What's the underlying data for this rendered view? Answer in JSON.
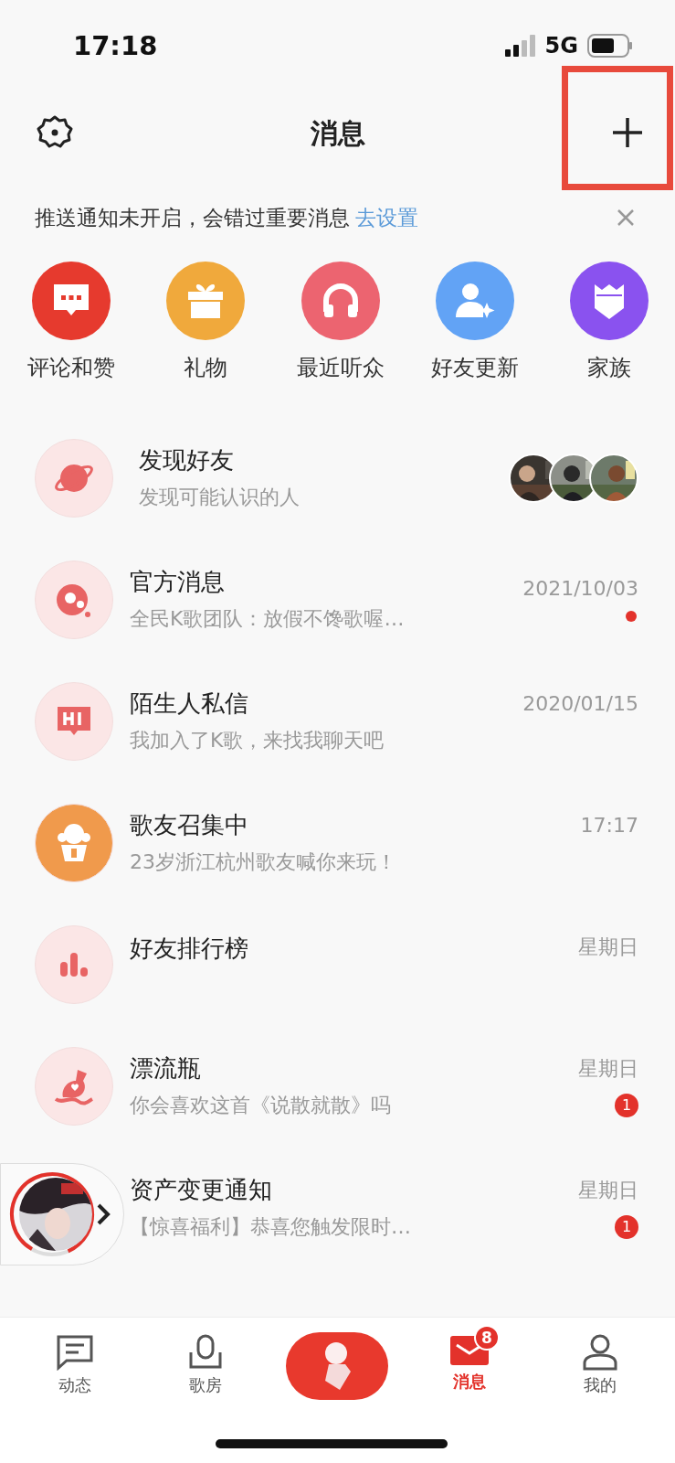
{
  "status_bar": {
    "time": "17:18",
    "network": "5G"
  },
  "header": {
    "title": "消息"
  },
  "notice": {
    "text": "推送通知未开启，会错过重要消息",
    "link": "去设置"
  },
  "quick_actions": [
    {
      "label": "评论和赞",
      "color": "#e63a2e"
    },
    {
      "label": "礼物",
      "color": "#f0a93c"
    },
    {
      "label": "最近听众",
      "color": "#ec6470"
    },
    {
      "label": "好友更新",
      "color": "#62a3f5"
    },
    {
      "label": "家族",
      "color": "#8a52ef"
    }
  ],
  "discover": {
    "title": "发现好友",
    "subtitle": "发现可能认识的人"
  },
  "messages": [
    {
      "title": "官方消息",
      "preview": "全民K歌团队：放假不馋歌喔…",
      "time": "2021/10/03",
      "unread_dot": true
    },
    {
      "title": "陌生人私信",
      "preview": "我加入了K歌，来找我聊天吧",
      "time": "2020/01/15",
      "unread_dot": false
    },
    {
      "title": "歌友召集中",
      "preview": "23岁浙江杭州歌友喊你来玩！",
      "time": "17:17",
      "unread_dot": false
    },
    {
      "title": "好友排行榜",
      "time": "星期日",
      "unread_dot": false
    },
    {
      "title": "漂流瓶",
      "preview": "你会喜欢这首《说散就散》吗",
      "time": "星期日",
      "badge": "1",
      "unread_dot": false
    },
    {
      "title": "资产变更通知",
      "preview": "【惊喜福利】恭喜您触发限时…",
      "time": "星期日",
      "badge": "1",
      "unread_dot": false
    }
  ],
  "tab_bar": [
    {
      "label": "动态",
      "selected": false
    },
    {
      "label": "歌房",
      "selected": false
    },
    {
      "kind": "record",
      "selected": false
    },
    {
      "label": "消息",
      "selected": true,
      "badge": "8"
    },
    {
      "label": "我的",
      "selected": false
    }
  ]
}
